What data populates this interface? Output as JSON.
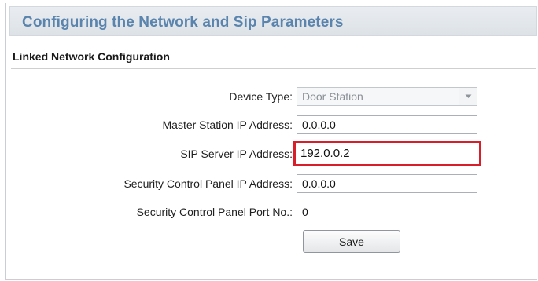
{
  "header": {
    "title": "Configuring the Network and Sip Parameters"
  },
  "section": {
    "title": "Linked Network Configuration"
  },
  "form": {
    "device_type": {
      "label": "Device Type:",
      "value": "Door Station"
    },
    "master_station_ip": {
      "label": "Master Station IP Address:",
      "value": "0.0.0.0"
    },
    "sip_server_ip": {
      "label": "SIP Server IP Address:",
      "value": "192.0.0.2"
    },
    "security_panel_ip": {
      "label": "Security Control Panel IP Address:",
      "value": "0.0.0.0"
    },
    "security_panel_port": {
      "label": "Security Control Panel Port No.:",
      "value": "0"
    },
    "save_label": "Save"
  },
  "colors": {
    "title_text": "#5a84ad",
    "highlight_border": "#d81e2a"
  },
  "icons": {
    "dropdown": "chevron-down-icon"
  }
}
